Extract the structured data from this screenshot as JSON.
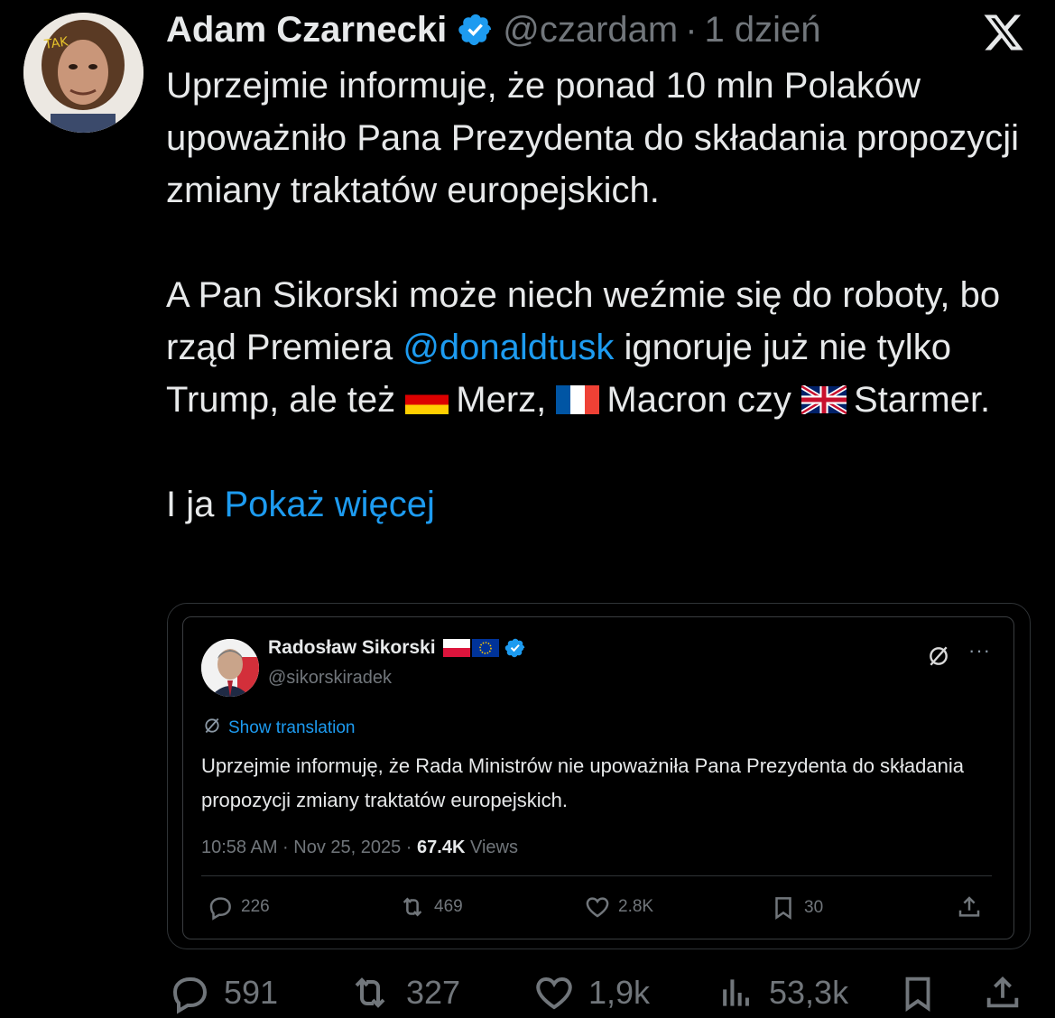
{
  "tweet": {
    "author_name": "Adam Czarnecki",
    "handle": "@czardam",
    "separator": "·",
    "time": "1 dzień",
    "paragraph1": "Uprzejmie informuje, że ponad 10 mln Polaków upoważniło Pana Prezydenta do składania propozycji zmiany traktatów europejskich.",
    "p2_part1": "A Pan Sikorski może niech weźmie się do roboty, bo rząd Premiera ",
    "p2_mention": "@donaldtusk",
    "p2_part2": " ignoruje już nie tylko Trump, ale też ",
    "p2_merz": "Merz, ",
    "p2_macron": "Macron czy ",
    "p2_starmer": "Starmer.",
    "p3_text": "I ja ",
    "show_more": "Pokaż więcej"
  },
  "quoted": {
    "author_name": "Radosław Sikorski",
    "handle": "@sikorskiradek",
    "show_translation": "Show translation",
    "text": "Uprzejmie informuję, że Rada Ministrów nie upoważniła Pana Prezydenta do składania propozycji zmiany traktatów europejskich.",
    "timestamp": "10:58 AM · Nov 25, 2025 · ",
    "views_count": "67.4K",
    "views_label": " Views",
    "replies": "226",
    "reposts": "469",
    "likes": "2.8K",
    "bookmarks": "30"
  },
  "actions": {
    "replies": "591",
    "reposts": "327",
    "likes": "1,9k",
    "views": "53,3k"
  },
  "colors": {
    "background": "#000000",
    "text": "#e7e9ea",
    "muted": "#71767b",
    "link": "#1d9bf0",
    "verified": "#1d9bf0"
  },
  "icons": [
    "verified-badge-icon",
    "x-logo-icon",
    "reply-icon",
    "repost-icon",
    "like-icon",
    "views-icon",
    "bookmark-icon",
    "share-icon",
    "grok-icon",
    "more-icon",
    "flag-de-icon",
    "flag-fr-icon",
    "flag-uk-icon",
    "flag-pl-icon",
    "flag-eu-icon"
  ]
}
